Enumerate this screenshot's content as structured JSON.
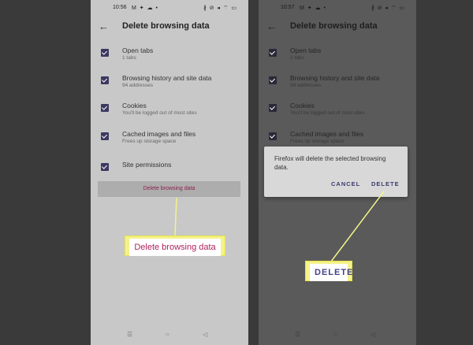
{
  "left": {
    "status": {
      "time": "10:56",
      "notif": "M ✦ ☁ •",
      "sys": "∦ ⊘ ◂ ⌔ ▭"
    },
    "title": "Delete browsing data",
    "options": [
      {
        "label": "Open tabs",
        "sub": "1 tabs"
      },
      {
        "label": "Browsing history and site data",
        "sub": "94 addresses"
      },
      {
        "label": "Cookies",
        "sub": "You'll be logged out of most sites"
      },
      {
        "label": "Cached images and files",
        "sub": "Frees up storage space"
      },
      {
        "label": "Site permissions",
        "sub": ""
      }
    ],
    "button": "Delete browsing data"
  },
  "right": {
    "status": {
      "time": "10:57",
      "notif": "M ✦ ☁ •",
      "sys": "∦ ⊘ ◂ ⌔ ▭"
    },
    "title": "Delete browsing data",
    "options": [
      {
        "label": "Open tabs",
        "sub": "1 tabs"
      },
      {
        "label": "Browsing history and site data",
        "sub": "94 addresses"
      },
      {
        "label": "Cookies",
        "sub": "You'll be logged out of most sites"
      },
      {
        "label": "Cached images and files",
        "sub": "Frees up storage space"
      }
    ],
    "dialog": {
      "message": "Firefox will delete the selected browsing data.",
      "cancel": "CANCEL",
      "delete": "DELETE"
    }
  },
  "callouts": {
    "left": "Delete browsing data",
    "right": "DELETE"
  },
  "nav": {
    "recent": "☰",
    "home": "○",
    "back": "◁"
  },
  "colors": {
    "accent": "#3b3860",
    "callout_yellow": "#f4f28a",
    "delete_text": "#8a2050"
  }
}
